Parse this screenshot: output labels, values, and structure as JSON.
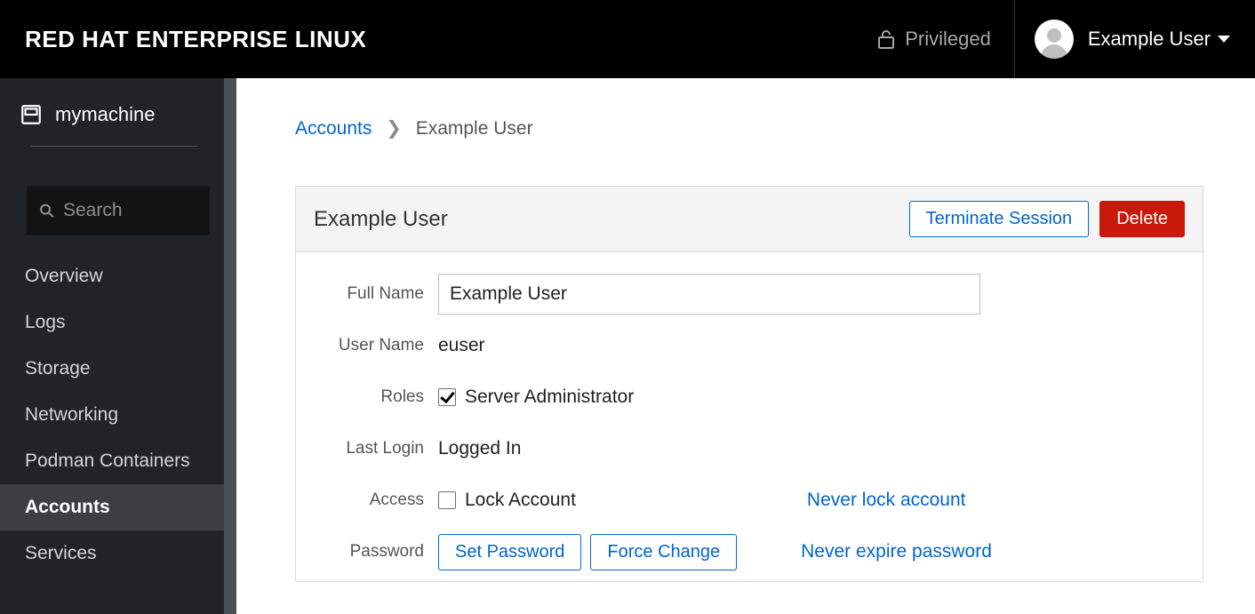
{
  "header": {
    "brand": "RED HAT ENTERPRISE LINUX",
    "privileged_label": "Privileged",
    "user_display": "Example User"
  },
  "sidebar": {
    "host": "mymachine",
    "search_placeholder": "Search",
    "items": [
      {
        "label": "Overview",
        "active": false
      },
      {
        "label": "Logs",
        "active": false
      },
      {
        "label": "Storage",
        "active": false
      },
      {
        "label": "Networking",
        "active": false
      },
      {
        "label": "Podman Containers",
        "active": false
      },
      {
        "label": "Accounts",
        "active": true
      },
      {
        "label": "Services",
        "active": false
      }
    ]
  },
  "breadcrumb": {
    "root": "Accounts",
    "sep": "❯",
    "current": "Example User"
  },
  "card": {
    "title": "Example User",
    "terminate_btn": "Terminate Session",
    "delete_btn": "Delete"
  },
  "form": {
    "full_name_label": "Full Name",
    "full_name_value": "Example User",
    "user_name_label": "User Name",
    "user_name_value": "euser",
    "roles_label": "Roles",
    "role_admin_label": "Server Administrator",
    "last_login_label": "Last Login",
    "last_login_value": "Logged In",
    "access_label": "Access",
    "lock_account_label": "Lock Account",
    "never_lock_link": "Never lock account",
    "password_label": "Password",
    "set_password_btn": "Set Password",
    "force_change_btn": "Force Change",
    "never_expire_link": "Never expire password"
  }
}
